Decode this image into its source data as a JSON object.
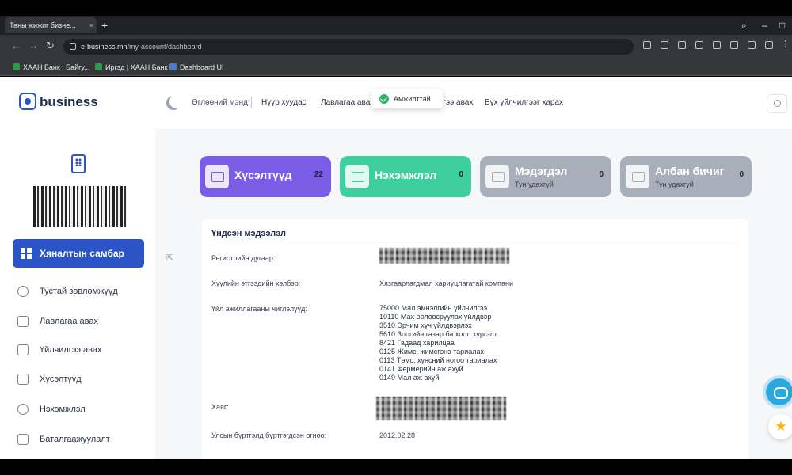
{
  "browser": {
    "tab_title": "Таны жижиг бизне...",
    "tab_close": "×",
    "new_tab": "+",
    "url_host": "e-business.mn",
    "url_path": "/my-account/dashboard",
    "bookmarks": [
      {
        "label": "ХААН Банк | Байгу...",
        "color": "#2e9a48"
      },
      {
        "label": "Иргэд | ХААН Банк",
        "color": "#2e9a48"
      },
      {
        "label": "Dashboard UI",
        "color": "#4a7bd0"
      }
    ]
  },
  "sidebar": {
    "logo_text": "business",
    "active_item": "Хяналтын самбар",
    "items": [
      {
        "label": "Тустай зөвлөмжүүд"
      },
      {
        "label": "Лавлагаа авах"
      },
      {
        "label": "Үйлчилгээ авах"
      },
      {
        "label": "Хүсэлтүүд"
      },
      {
        "label": "Нэхэмжлэл"
      },
      {
        "label": "Баталгаажуулалт"
      }
    ]
  },
  "header": {
    "greeting": "Өглөөний мэнд!",
    "nav": [
      "Нүүр хуудас",
      "Лавлагаа авах",
      "Үйлчилгээ авах",
      "Бүх үйлчилгээг харах"
    ]
  },
  "toast": {
    "text": "Амжилттай"
  },
  "cards": [
    {
      "title": "Хүсэлтүүд",
      "count": "22",
      "color": "#7b5ce6"
    },
    {
      "title": "Нэхэмжлэл",
      "count": "0",
      "color": "#3fcf9e"
    },
    {
      "title": "Мэдэгдэл",
      "subtitle": "Тун удахгүй",
      "count": "0",
      "color": "#a9afba"
    },
    {
      "title": "Албан бичиг",
      "subtitle": "Тун удахгүй",
      "count": "0",
      "color": "#a9afba"
    }
  ],
  "info": {
    "title": "Үндсэн мэдээлэл",
    "reg_label": "Регистрийн дугаар:",
    "legal_label": "Хуулийн этгээдийн хэлбэр:",
    "legal_value": "Хязгаарлагдмал хариуцлагатай компани",
    "activities_label": "Үйл ажиллагааны чиглэлүүд:",
    "activities": [
      "75000 Мал эмнэлгийн үйлчилгээ",
      "10110 Мах боловсруулах үйлдвэр",
      "3510 Эрчим хүч үйлдвэрлэх",
      "5610 Зоогийн газар ба хоол хүргэлт",
      "8421 Гадаад харилцаа",
      "0125 Жимс, жимсгэнэ тариалах",
      "0113 Төмс, хүнсний ногоо тариалах",
      "0141 Фермерийн аж ахуй",
      "0149 Мал аж ахуй"
    ],
    "address_label": "Хаяг:",
    "date_label": "Улсын бүртгэлд бүртгэгдсэн огноо:",
    "date_value": "2012.02.28"
  }
}
